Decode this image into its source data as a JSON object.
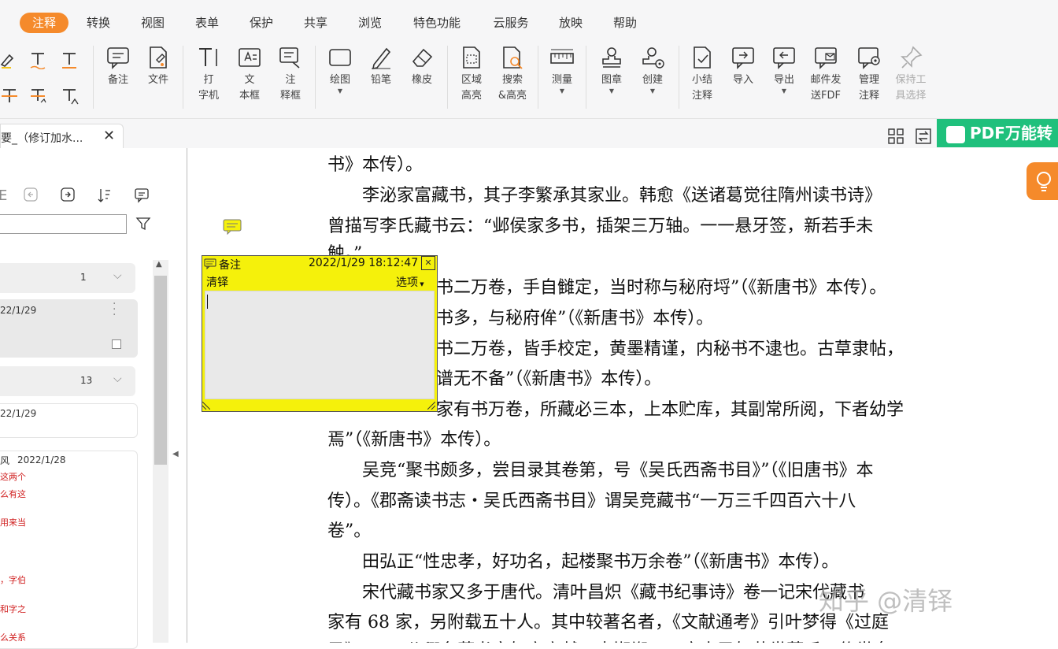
{
  "menu": {
    "items": [
      "注释",
      "转换",
      "视图",
      "表单",
      "保护",
      "共享",
      "浏览",
      "特色功能",
      "云服务",
      "放映",
      "帮助"
    ],
    "active": "注释"
  },
  "ribbon": {
    "tools": [
      {
        "line1": "备注",
        "line2": "",
        "icon": "note-icon"
      },
      {
        "line1": "文件",
        "line2": "",
        "icon": "file-attach-icon"
      },
      {
        "line1": "打",
        "line2": "字机",
        "icon": "typewriter-icon"
      },
      {
        "line1": "文",
        "line2": "本框",
        "icon": "textbox-icon"
      },
      {
        "line1": "注",
        "line2": "释框",
        "icon": "callout-icon"
      },
      {
        "line1": "绘图",
        "line2": "",
        "icon": "draw-shape-icon",
        "dropdown": true
      },
      {
        "line1": "铅笔",
        "line2": "",
        "icon": "pencil-icon"
      },
      {
        "line1": "橡皮",
        "line2": "",
        "icon": "eraser-icon"
      },
      {
        "line1": "区域",
        "line2": "高亮",
        "icon": "area-highlight-icon"
      },
      {
        "line1": "搜索",
        "line2": "&高亮",
        "icon": "search-highlight-icon"
      },
      {
        "line1": "测量",
        "line2": "",
        "icon": "ruler-icon",
        "dropdown": true
      },
      {
        "line1": "图章",
        "line2": "",
        "icon": "stamp-icon",
        "dropdown": true
      },
      {
        "line1": "创建",
        "line2": "",
        "icon": "create-stamp-icon",
        "dropdown": true
      },
      {
        "line1": "小结",
        "line2": "注释",
        "icon": "summary-icon"
      },
      {
        "line1": "导入",
        "line2": "",
        "icon": "import-icon"
      },
      {
        "line1": "导出",
        "line2": "",
        "icon": "export-icon",
        "dropdown": true
      },
      {
        "line1": "邮件发",
        "line2": "送FDF",
        "icon": "mail-fdf-icon"
      },
      {
        "line1": "管理",
        "line2": "注释",
        "icon": "manage-comments-icon",
        "dropdown": true
      },
      {
        "line1": "保持工",
        "line2": "具选择",
        "icon": "pin-icon",
        "disabled": true
      }
    ]
  },
  "tab": {
    "title": "要_（修订加水...",
    "close": "✕"
  },
  "banner": {
    "text": "PDF万能转"
  },
  "sidebar": {
    "group1_count": "1",
    "card1_date": "22/1/29",
    "group2_count": "13",
    "card2_date": "22/1/29",
    "card3_author": "风",
    "card3_date": "2022/1/28",
    "card3_lines": [
      "这两个",
      "么有这",
      "用来当",
      "，字伯",
      "和字之",
      "么关系"
    ]
  },
  "note": {
    "title": "备注",
    "timestamp": "2022/1/29 18:12:47",
    "author": "清铎",
    "options": "选项",
    "close": "✕"
  },
  "document": {
    "lines": [
      "书》本传）。",
      "　　李泌家富藏书，其子李繁承其家业。韩愈《送诸葛觉往隋州读书诗》",
      "曾描写李氏藏书云：“邺侯家多书，插架三万轴。一一悬牙签，新若手未",
      "触。”",
      "书二万卷，手自雠定，当时称与秘府埒”（《新唐书》本传）。",
      "书多，与秘府侔”（《新唐书》本传）。",
      "书二万卷，皆手校定，黄墨精谨，内秘书不逮也。古草隶帖，",
      "谱无不备”（《新唐书》本传）。",
      "家有书万卷，所藏必三本，上本贮库，其副常所阅，下者幼学",
      "焉”（《新唐书》本传）。",
      "　　吴竞“聚书颇多，尝目录其卷第，号《吴氏西斋书目》”（《旧唐书》本",
      "传）。《郡斋读书志・吴氏西斋书目》谓吴竞藏书“一万三千四百六十八",
      "卷”。",
      "　　田弘正“性忠孝，好功名，起楼聚书万余卷”（《新唐书》本传）。",
      "　　宋代藏书家又多于唐代。清叶昌炽《藏书纪事诗》卷一记宋代藏书",
      "家有 68 家，另附载五十人。其中较著名者，《文献通考》引叶梦得《过庭",
      "录》云：“公卿名藏书家如宋宣献、李邯郸、四方士民如荣世蒙氏、传世阜"
    ]
  },
  "watermark": "知乎 @清铎",
  "colors": {
    "accent": "#f58a2b",
    "note_yellow": "#f5f10b",
    "banner_green": "#1fc07c"
  }
}
